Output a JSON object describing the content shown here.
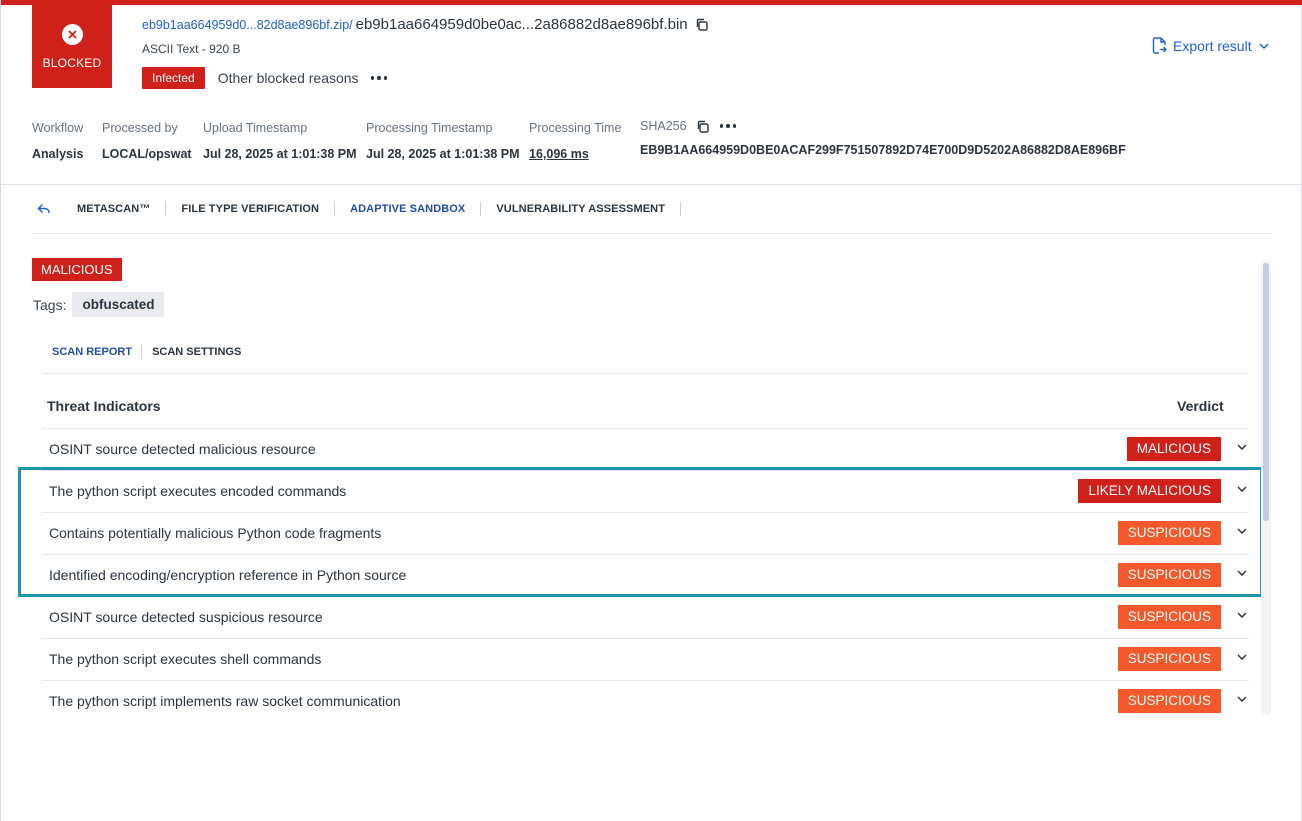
{
  "header": {
    "status_label": "BLOCKED",
    "file_link": "eb9b1aa664959d0...82d8ae896bf.zip/",
    "file_name": "eb9b1aa664959d0be0ac...2a86882d8ae896bf.bin",
    "file_meta": "ASCII Text - 920 B",
    "infected_label": "Infected",
    "other_reasons": "Other blocked reasons",
    "export_label": "Export result"
  },
  "meta": {
    "workflow": {
      "label": "Workflow",
      "value": "Analysis"
    },
    "processed_by": {
      "label": "Processed by",
      "value": "LOCAL/opswat"
    },
    "upload_timestamp": {
      "label": "Upload Timestamp",
      "value": "Jul 28, 2025 at 1:01:38 PM"
    },
    "processing_timestamp": {
      "label": "Processing Timestamp",
      "value": "Jul 28, 2025 at 1:01:38 PM"
    },
    "processing_time": {
      "label": "Processing Time",
      "value": "16,096 ms"
    },
    "sha256": {
      "label": "SHA256",
      "value": "EB9B1AA664959D0BE0ACAF299F751507892D74E700D9D5202A86882D8AE896BF"
    }
  },
  "tabs": [
    {
      "label": "METASCAN™",
      "active": false
    },
    {
      "label": "FILE TYPE VERIFICATION",
      "active": false
    },
    {
      "label": "ADAPTIVE SANDBOX",
      "active": true
    },
    {
      "label": "VULNERABILITY ASSESSMENT",
      "active": false
    }
  ],
  "verdict": {
    "overall": "MALICIOUS",
    "tags_label": "Tags:",
    "tags": [
      "obfuscated"
    ]
  },
  "subtabs": [
    {
      "label": "SCAN REPORT",
      "active": true
    },
    {
      "label": "SCAN SETTINGS",
      "active": false
    }
  ],
  "table": {
    "headers": {
      "threat": "Threat Indicators",
      "verdict": "Verdict"
    },
    "rows": [
      {
        "text": "OSINT source detected malicious resource",
        "verdict": "MALICIOUS"
      },
      {
        "text": "The python script executes encoded commands",
        "verdict": "LIKELY MALICIOUS"
      },
      {
        "text": "Contains potentially malicious Python code fragments",
        "verdict": "SUSPICIOUS"
      },
      {
        "text": "Identified encoding/encryption reference in Python source",
        "verdict": "SUSPICIOUS"
      },
      {
        "text": "OSINT source detected suspicious resource",
        "verdict": "SUSPICIOUS"
      },
      {
        "text": "The python script executes shell commands",
        "verdict": "SUSPICIOUS"
      },
      {
        "text": "The python script implements raw socket communication",
        "verdict": "SUSPICIOUS"
      }
    ]
  },
  "colors": {
    "danger": "#d0201a",
    "suspicious": "#f4592b",
    "link": "#1f5fd6",
    "highlight": "#1e95b5"
  }
}
